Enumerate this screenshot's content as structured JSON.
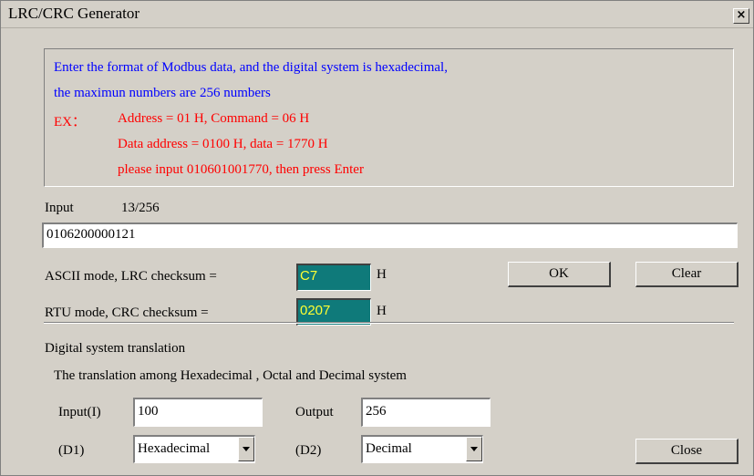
{
  "window": {
    "title": "LRC/CRC Generator",
    "close_label": "×"
  },
  "info": {
    "line1": "Enter the format of Modbus data, and the digital system is hexadecimal,",
    "line2": "the maximun numbers are 256  numbers",
    "ex_label": "EX：",
    "ex1": "Address = 01 H, Command = 06 H",
    "ex2": "Data address = 0100 H, data = 1770 H",
    "ex3": "please input 010601001770, then press Enter"
  },
  "input": {
    "label": "Input",
    "count": "13/256",
    "value": "0106200000121"
  },
  "checksum": {
    "ascii_label": "ASCII mode, LRC checksum =",
    "ascii_value": "C7",
    "rtu_label": "RTU  mode, CRC checksum =",
    "rtu_value": "0207",
    "unit": "H"
  },
  "buttons": {
    "ok": "OK",
    "clear": "Clear",
    "close": "Close"
  },
  "translation": {
    "heading": "Digital system translation",
    "description": "The translation among Hexadecimal , Octal and Decimal system",
    "input_label": "Input(I)",
    "input_value": "100",
    "output_label": "Output",
    "output_value": "256",
    "d1_label": "(D1)",
    "d1_value": "Hexadecimal",
    "d2_label": "(D2)",
    "d2_value": "Decimal"
  },
  "colors": {
    "info_blue": "#0000ff",
    "info_red": "#ff0000",
    "checksum_bg": "#0f7a7a",
    "checksum_text": "#ffff33"
  },
  "icons": {
    "close": "close-icon",
    "dropdown": "chevron-down-icon"
  }
}
